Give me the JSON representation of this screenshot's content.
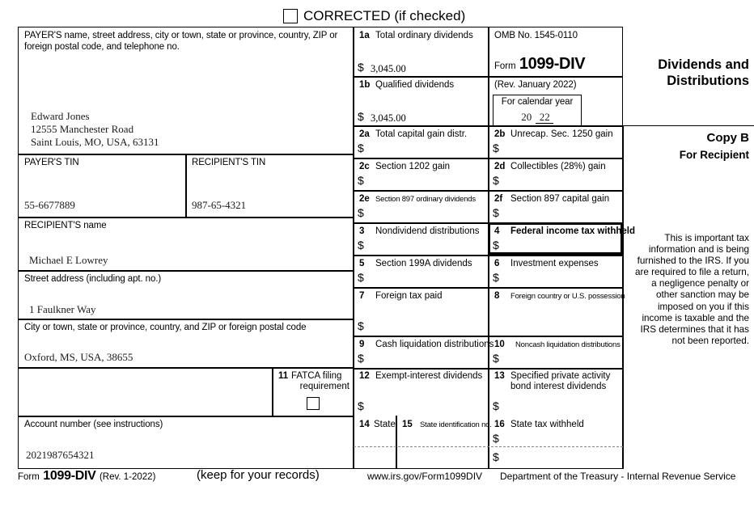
{
  "form": {
    "corrected_label": "CORRECTED (if checked)",
    "omb": "OMB No. 1545-0110",
    "form_word": "Form",
    "form_number": "1099-DIV",
    "revision": "(Rev. January 2022)",
    "calendar_year_label": "For calendar year",
    "year_prefix": "20",
    "year_suffix": "22",
    "title_line1": "Dividends and",
    "title_line2": "Distributions",
    "copy_label": "Copy B",
    "copy_for": "For Recipient",
    "notice": "This is important tax information and is being furnished to the IRS. If you are required to file a return, a negligence penalty or other sanction may be imposed on you if this income is taxable and the IRS determines that it has not been reported.",
    "footer_form_word": "Form",
    "footer_form_number": "1099-DIV",
    "footer_revision": "(Rev. 1-2022)",
    "footer_keep": "(keep for your records)",
    "footer_url": "www.irs.gov/Form1099DIV",
    "footer_dept": "Department of the Treasury - Internal Revenue Service"
  },
  "payer": {
    "header": "PAYER'S name, street address, city or town, state or province, country, ZIP or foreign postal code, and telephone no.",
    "name": "Edward Jones",
    "street": "12555 Manchester Road",
    "citystatezip": "Saint Louis, MO, USA, 63131",
    "tin_label": "PAYER'S TIN",
    "tin": "55-6677889"
  },
  "recipient": {
    "tin_label": "RECIPIENT'S TIN",
    "tin": "987-65-4321",
    "name_label": "RECIPIENT'S name",
    "name": "Michael E Lowrey",
    "street_label": "Street address (including apt. no.)",
    "street": "1 Faulkner Way",
    "city_label": "City or town, state or province, country, and ZIP or foreign postal code",
    "city": "Oxford, MS, USA, 38655",
    "account_label": "Account number (see instructions)",
    "account": "2021987654321"
  },
  "boxes": {
    "b1a": {
      "num": "1a",
      "label": "Total ordinary dividends",
      "currency": "$",
      "value": "3,045.00"
    },
    "b1b": {
      "num": "1b",
      "label": "Qualified dividends",
      "currency": "$",
      "value": "3,045.00"
    },
    "b2a": {
      "num": "2a",
      "label": "Total capital gain distr.",
      "currency": "$",
      "value": ""
    },
    "b2b": {
      "num": "2b",
      "label": "Unrecap. Sec. 1250 gain",
      "currency": "$",
      "value": ""
    },
    "b2c": {
      "num": "2c",
      "label": "Section 1202 gain",
      "currency": "$",
      "value": ""
    },
    "b2d": {
      "num": "2d",
      "label": "Collectibles (28%) gain",
      "currency": "$",
      "value": ""
    },
    "b2e": {
      "num": "2e",
      "label": "Section 897 ordinary dividends",
      "currency": "$",
      "value": ""
    },
    "b2f": {
      "num": "2f",
      "label": "Section 897 capital gain",
      "currency": "$",
      "value": ""
    },
    "b3": {
      "num": "3",
      "label": "Nondividend distributions",
      "currency": "$",
      "value": ""
    },
    "b4": {
      "num": "4",
      "label": "Federal income tax withheld",
      "currency": "$",
      "value": ""
    },
    "b5": {
      "num": "5",
      "label": "Section 199A dividends",
      "currency": "$",
      "value": ""
    },
    "b6": {
      "num": "6",
      "label": "Investment expenses",
      "currency": "$",
      "value": ""
    },
    "b7": {
      "num": "7",
      "label": "Foreign tax paid",
      "currency": "$",
      "value": ""
    },
    "b8": {
      "num": "8",
      "label": "Foreign country or U.S. possession",
      "currency": "",
      "value": ""
    },
    "b9": {
      "num": "9",
      "label": "Cash liquidation distributions",
      "currency": "$",
      "value": ""
    },
    "b10": {
      "num": "10",
      "label": "Noncash liquidation distributions",
      "currency": "$",
      "value": ""
    },
    "b11": {
      "num": "11",
      "label_line1": "FATCA filing",
      "label_line2": "requirement",
      "checked": false
    },
    "b12": {
      "num": "12",
      "label": "Exempt-interest dividends",
      "currency": "$",
      "value": ""
    },
    "b13": {
      "num": "13",
      "label_line1": "Specified private activity",
      "label_line2": "bond interest dividends",
      "currency": "$",
      "value": ""
    },
    "b14": {
      "num": "14",
      "label": "State",
      "row1": "",
      "row2": ""
    },
    "b15": {
      "num": "15",
      "label": "State identification no.",
      "row1": "",
      "row2": ""
    },
    "b16": {
      "num": "16",
      "label": "State tax withheld",
      "currency": "$",
      "row1": "",
      "row2": ""
    }
  }
}
